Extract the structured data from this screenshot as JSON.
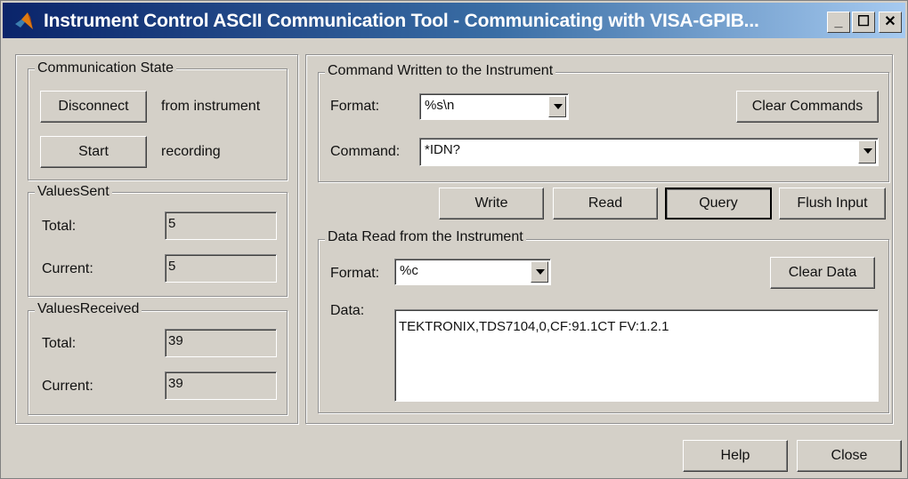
{
  "window": {
    "title": "Instrument Control ASCII Communication Tool - Communicating with VISA-GPIB...",
    "minimize_glyph": "_",
    "maximize_glyph": "☐",
    "close_glyph": "✕"
  },
  "communication_state": {
    "title": "Communication State",
    "disconnect_label": "Disconnect",
    "disconnect_text": "from instrument",
    "start_label": "Start",
    "start_text": "recording"
  },
  "values_sent": {
    "title": "ValuesSent",
    "total_label": "Total:",
    "total_value": "5",
    "current_label": "Current:",
    "current_value": "5"
  },
  "values_received": {
    "title": "ValuesReceived",
    "total_label": "Total:",
    "total_value": "39",
    "current_label": "Current:",
    "current_value": "39"
  },
  "command_written": {
    "title": "Command Written to the Instrument",
    "format_label": "Format:",
    "format_value": "%s\\n",
    "clear_commands_label": "Clear Commands",
    "command_label": "Command:",
    "command_value": "*IDN?"
  },
  "actions": {
    "write_label": "Write",
    "read_label": "Read",
    "query_label": "Query",
    "flush_label": "Flush Input"
  },
  "data_read": {
    "title": "Data Read from the Instrument",
    "format_label": "Format:",
    "format_value": "%c",
    "clear_data_label": "Clear Data",
    "data_label": "Data:",
    "data_value": "TEKTRONIX,TDS7104,0,CF:91.1CT FV:1.2.1"
  },
  "footer": {
    "help_label": "Help",
    "close_label": "Close"
  }
}
